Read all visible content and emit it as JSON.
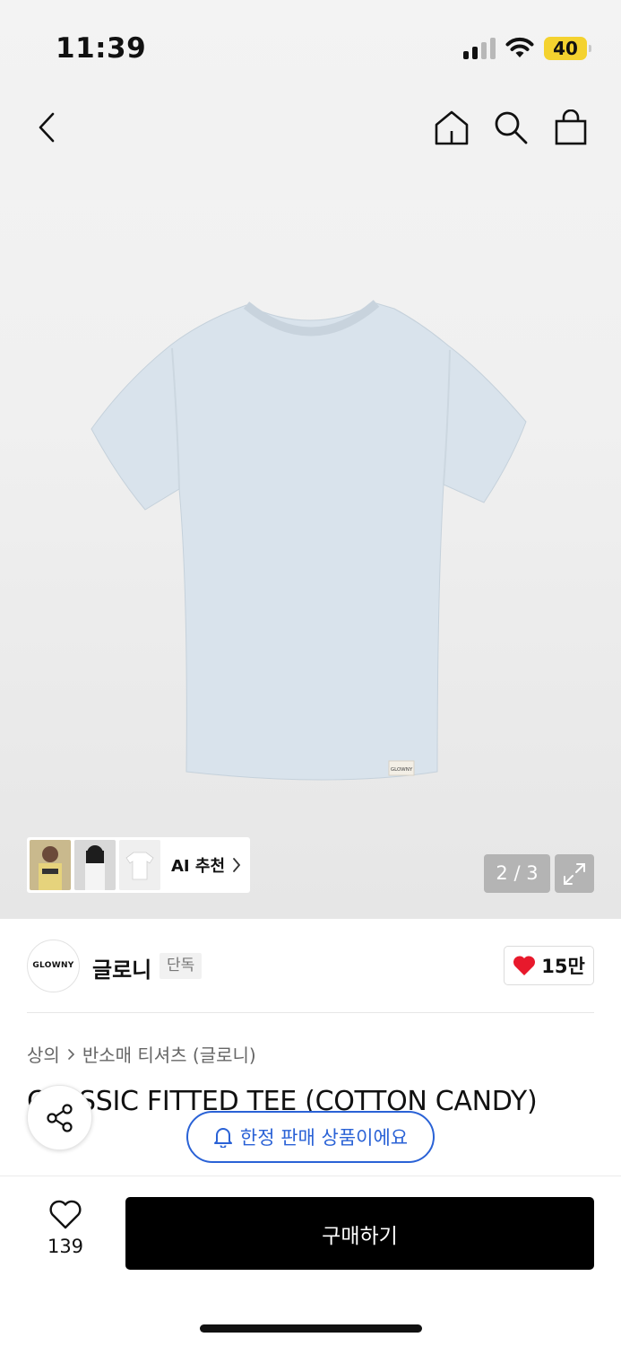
{
  "status_bar": {
    "time": "11:39",
    "battery": "40"
  },
  "nav": {
    "back_icon": "chevron-left-icon",
    "home_icon": "home-icon",
    "search_icon": "search-icon",
    "bag_icon": "shopping-bag-icon"
  },
  "gallery": {
    "ai_recommend_label": "AI 추천",
    "page_indicator": "2 / 3",
    "product_label": "GLOWNY",
    "product_color": "#d9e3ec"
  },
  "brand": {
    "logo_text": "GLOWNY",
    "name": "글로니",
    "badge": "단독",
    "like_count": "15만"
  },
  "breadcrumb": {
    "category": "상의",
    "subcategory": "반소매 티셔츠 (글로니)"
  },
  "product": {
    "title": "CLASSIC FITTED TEE (COTTON CANDY)"
  },
  "notice": {
    "limited_sale": "한정 판매 상품이에요"
  },
  "bottom": {
    "wish_count": "139",
    "buy_label": "구매하기"
  },
  "colors": {
    "accent_blue": "#2a62d6",
    "heart_red": "#e8192c",
    "buy_black": "#000000"
  }
}
